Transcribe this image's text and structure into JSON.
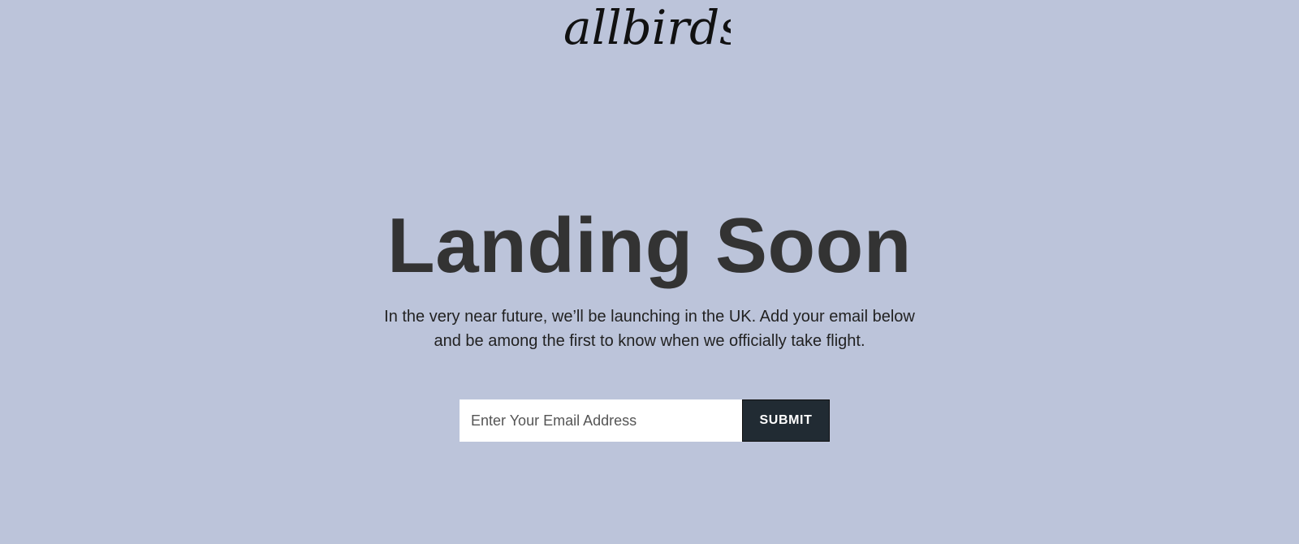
{
  "colors": {
    "background": "#bcc4da",
    "headline": "#333333",
    "body_text": "#222222",
    "logo": "#111111",
    "input_background": "#ffffff",
    "button_background": "#212b33",
    "button_text": "#ffffff"
  },
  "header": {
    "logo_text": "allbirds"
  },
  "main": {
    "headline": "Landing Soon",
    "subtext": "In the very near future, we’ll be launching in the UK. Add your email below and be among the first to know when we officially take flight."
  },
  "signup": {
    "email_placeholder": "Enter Your Email Address",
    "email_value": "",
    "submit_label": "SUBMIT"
  }
}
